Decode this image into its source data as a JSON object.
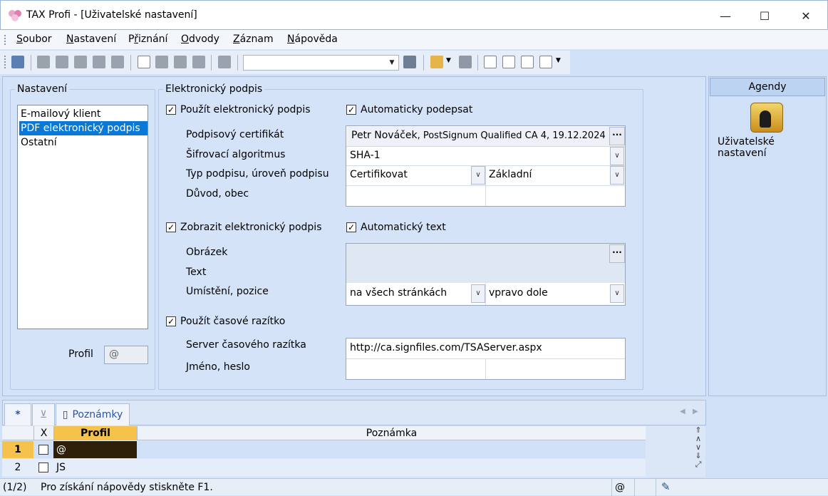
{
  "window": {
    "title": "TAX Profi - [Uživatelské nastavení]",
    "minimize": "—",
    "maximize": "☐",
    "close": "✕"
  },
  "menu": [
    {
      "underline": "S",
      "rest": "oubor"
    },
    {
      "underline": "N",
      "rest": "astavení"
    },
    {
      "pre": "P",
      "underline": "ř",
      "rest": "iznání"
    },
    {
      "underline": "O",
      "rest": "dvody"
    },
    {
      "underline": "Z",
      "rest": "áznam"
    },
    {
      "underline": "N",
      "rest": "ápověda"
    }
  ],
  "nastaveni": {
    "legend": "Nastavení",
    "items": [
      "E-mailový klient",
      "PDF elektronický podpis",
      "Ostatní"
    ],
    "selected_index": 1,
    "profil_label": "Profil",
    "profil_value": "@"
  },
  "podpis": {
    "legend": "Elektronický podpis",
    "pouzit": {
      "label": "Použít elektronický podpis",
      "checked": true
    },
    "auto_podepsat": {
      "label": "Automaticky podepsat",
      "checked": true
    },
    "certifikat_label": "Podpisový certifikát",
    "certifikat_name": "Petr Nováček",
    "certifikat_rest": ", PostSignum Qualified CA 4, 19.12.2024",
    "algoritmus_label": "Šifrovací algoritmus",
    "algoritmus_value": "SHA-1",
    "typ_label": "Typ podpisu, úroveň podpisu",
    "typ_value": "Certifikovat",
    "uroven_value": "Základní",
    "duvod_label": "Důvod, obec",
    "zobrazit": {
      "label": "Zobrazit elektronický podpis",
      "checked": true
    },
    "auto_text": {
      "label": "Automatický text",
      "checked": true
    },
    "obrazek_label": "Obrázek",
    "text_label": "Text",
    "umisteni_label": "Umístění, pozice",
    "umisteni_value": "na všech stránkách",
    "pozice_value": "vpravo dole",
    "razitko": {
      "label": "Použít časové razítko",
      "checked": true
    },
    "server_label": "Server časového razítka",
    "server_value": "http://ca.signfiles.com/TSAServer.aspx",
    "jmeno_label": "Jméno, heslo",
    "dots": "···"
  },
  "agendy": {
    "header": "Agendy",
    "item_label": "Uživatelské nastavení"
  },
  "tabs": {
    "star": "*",
    "poznamky": "Poznámky"
  },
  "grid": {
    "headers": {
      "x": "X",
      "profil": "Profil",
      "poznamka": "Poznámka"
    },
    "rows": [
      {
        "num": "1",
        "checked": false,
        "profil": "@",
        "poznamka": ""
      },
      {
        "num": "2",
        "checked": false,
        "profil": "JS",
        "poznamka": ""
      }
    ]
  },
  "status": {
    "position": "(1/2)",
    "help": "Pro získání nápovědy stiskněte F1.",
    "profile": "@"
  },
  "colors": {
    "accent": "#0a78d6",
    "header_yellow": "#f5c24b",
    "selected_row": "#2e1f08"
  }
}
